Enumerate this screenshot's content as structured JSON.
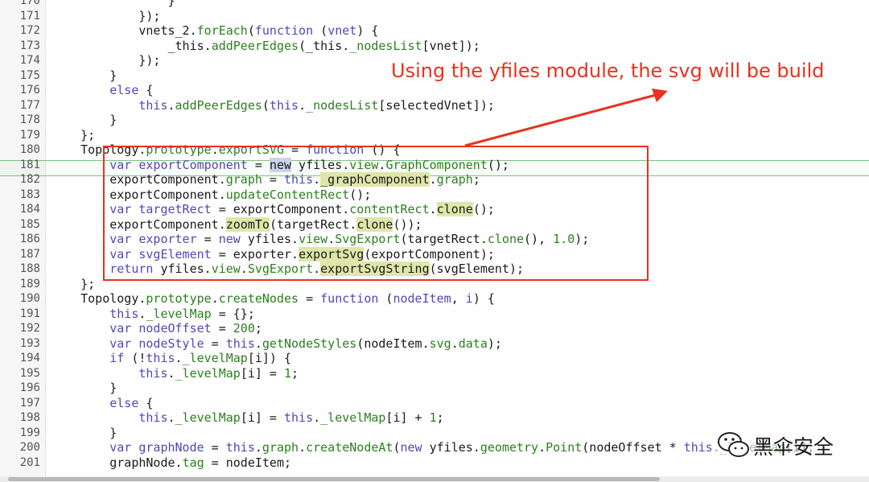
{
  "lines": [
    {
      "n": "170",
      "t": [
        [
          "                }"
        ]
      ]
    },
    {
      "n": "171",
      "t": [
        [
          "            });"
        ]
      ]
    },
    {
      "n": "172",
      "t": [
        [
          "            vnets_2."
        ],
        [
          "forEach",
          "mb"
        ],
        [
          "("
        ],
        [
          "function",
          "kw"
        ],
        [
          " ("
        ],
        [
          "vnet",
          "kw"
        ],
        [
          ") {"
        ]
      ]
    },
    {
      "n": "173",
      "t": [
        [
          "                _this."
        ],
        [
          "addPeerEdges",
          "mb"
        ],
        [
          "(_this."
        ],
        [
          "_nodesList",
          "mb"
        ],
        [
          "[vnet]);"
        ]
      ]
    },
    {
      "n": "174",
      "t": [
        [
          "            });"
        ]
      ]
    },
    {
      "n": "175",
      "t": [
        [
          "        }"
        ]
      ]
    },
    {
      "n": "176",
      "t": [
        [
          "        "
        ],
        [
          "else",
          "kw"
        ],
        [
          " {"
        ]
      ]
    },
    {
      "n": "177",
      "t": [
        [
          "            "
        ],
        [
          "this",
          "th"
        ],
        [
          "."
        ],
        [
          "addPeerEdges",
          "mb"
        ],
        [
          "("
        ],
        [
          "this",
          "th"
        ],
        [
          "."
        ],
        [
          "_nodesList",
          "mb"
        ],
        [
          "[selectedVnet]);"
        ]
      ]
    },
    {
      "n": "178",
      "t": [
        [
          "        }"
        ]
      ]
    },
    {
      "n": "179",
      "t": [
        [
          "    };"
        ]
      ]
    },
    {
      "n": "180",
      "t": [
        [
          "    Topology."
        ],
        [
          "prototype",
          "mb"
        ],
        [
          "."
        ],
        [
          "exportSVG",
          "mb"
        ],
        [
          " = "
        ],
        [
          "function",
          "kw"
        ],
        [
          " () {"
        ]
      ]
    },
    {
      "n": "181",
      "t": [
        [
          "        "
        ],
        [
          "var",
          "kw"
        ],
        [
          " "
        ],
        [
          "exportComponent",
          "kw"
        ],
        [
          " = "
        ],
        [
          "new",
          "hlk"
        ],
        [
          " yfiles."
        ],
        [
          "view",
          "mb"
        ],
        [
          "."
        ],
        [
          "GraphComponent",
          "mb"
        ],
        [
          "();"
        ]
      ]
    },
    {
      "n": "182",
      "t": [
        [
          "        exportComponent."
        ],
        [
          "graph",
          "mb"
        ],
        [
          " = "
        ],
        [
          "this",
          "th"
        ],
        [
          "."
        ],
        [
          "_graphComponent",
          "hl"
        ],
        [
          "."
        ],
        [
          "graph",
          "mb"
        ],
        [
          ";"
        ]
      ]
    },
    {
      "n": "183",
      "t": [
        [
          "        exportComponent."
        ],
        [
          "updateContentRect",
          "mb"
        ],
        [
          "();"
        ]
      ]
    },
    {
      "n": "184",
      "t": [
        [
          "        "
        ],
        [
          "var",
          "kw"
        ],
        [
          " "
        ],
        [
          "targetRect",
          "kw"
        ],
        [
          " = exportComponent."
        ],
        [
          "contentRect",
          "mb"
        ],
        [
          "."
        ],
        [
          "clone",
          "hl"
        ],
        [
          "();"
        ]
      ]
    },
    {
      "n": "185",
      "t": [
        [
          "        exportComponent."
        ],
        [
          "zoomTo",
          "hl"
        ],
        [
          "(targetRect."
        ],
        [
          "clone",
          "hl"
        ],
        [
          "());"
        ]
      ]
    },
    {
      "n": "186",
      "t": [
        [
          "        "
        ],
        [
          "var",
          "kw"
        ],
        [
          " "
        ],
        [
          "exporter",
          "kw"
        ],
        [
          " = "
        ],
        [
          "new",
          "kw"
        ],
        [
          " yfiles."
        ],
        [
          "view",
          "mb"
        ],
        [
          "."
        ],
        [
          "SvgExport",
          "mb"
        ],
        [
          "(targetRect."
        ],
        [
          "clone",
          "mb"
        ],
        [
          "(), "
        ],
        [
          "1.0",
          "num"
        ],
        [
          ");"
        ]
      ]
    },
    {
      "n": "187",
      "t": [
        [
          "        "
        ],
        [
          "var",
          "kw"
        ],
        [
          " "
        ],
        [
          "svgElement",
          "kw"
        ],
        [
          " = exporter."
        ],
        [
          "exportSvg",
          "hl"
        ],
        [
          "(exportComponent);"
        ]
      ]
    },
    {
      "n": "188",
      "t": [
        [
          "        "
        ],
        [
          "return",
          "kw"
        ],
        [
          " yfiles."
        ],
        [
          "view",
          "mb"
        ],
        [
          "."
        ],
        [
          "SvgExport",
          "mb"
        ],
        [
          "."
        ],
        [
          "exportSvgString",
          "hl"
        ],
        [
          "(svgElement);"
        ]
      ]
    },
    {
      "n": "189",
      "t": [
        [
          "    };"
        ]
      ]
    },
    {
      "n": "190",
      "t": [
        [
          "    Topology."
        ],
        [
          "prototype",
          "mb"
        ],
        [
          "."
        ],
        [
          "createNodes",
          "mb"
        ],
        [
          " = "
        ],
        [
          "function",
          "kw"
        ],
        [
          " ("
        ],
        [
          "nodeItem",
          "kw"
        ],
        [
          ", "
        ],
        [
          "i",
          "kw"
        ],
        [
          ") {"
        ]
      ]
    },
    {
      "n": "191",
      "t": [
        [
          "        "
        ],
        [
          "this",
          "th"
        ],
        [
          "."
        ],
        [
          "_levelMap",
          "mb"
        ],
        [
          " = {};"
        ]
      ]
    },
    {
      "n": "192",
      "t": [
        [
          "        "
        ],
        [
          "var",
          "kw"
        ],
        [
          " "
        ],
        [
          "nodeOffset",
          "kw"
        ],
        [
          " = "
        ],
        [
          "200",
          "num"
        ],
        [
          ";"
        ]
      ]
    },
    {
      "n": "193",
      "t": [
        [
          "        "
        ],
        [
          "var",
          "kw"
        ],
        [
          " "
        ],
        [
          "nodeStyle",
          "kw"
        ],
        [
          " = "
        ],
        [
          "this",
          "th"
        ],
        [
          "."
        ],
        [
          "getNodeStyles",
          "mb"
        ],
        [
          "(nodeItem."
        ],
        [
          "svg",
          "mb"
        ],
        [
          "."
        ],
        [
          "data",
          "mb"
        ],
        [
          ");"
        ]
      ]
    },
    {
      "n": "194",
      "t": [
        [
          "        "
        ],
        [
          "if",
          "kw"
        ],
        [
          " (!"
        ],
        [
          "this",
          "th"
        ],
        [
          "."
        ],
        [
          "_levelMap",
          "mb"
        ],
        [
          "[i]) {"
        ]
      ]
    },
    {
      "n": "195",
      "t": [
        [
          "            "
        ],
        [
          "this",
          "th"
        ],
        [
          "."
        ],
        [
          "_levelMap",
          "mb"
        ],
        [
          "[i] = "
        ],
        [
          "1",
          "num"
        ],
        [
          ";"
        ]
      ]
    },
    {
      "n": "196",
      "t": [
        [
          "        }"
        ]
      ]
    },
    {
      "n": "197",
      "t": [
        [
          "        "
        ],
        [
          "else",
          "kw"
        ],
        [
          " {"
        ]
      ]
    },
    {
      "n": "198",
      "t": [
        [
          "            "
        ],
        [
          "this",
          "th"
        ],
        [
          "."
        ],
        [
          "_levelMap",
          "mb"
        ],
        [
          "[i] = "
        ],
        [
          "this",
          "th"
        ],
        [
          "."
        ],
        [
          "_levelMap",
          "mb"
        ],
        [
          "[i] + "
        ],
        [
          "1",
          "num"
        ],
        [
          ";"
        ]
      ]
    },
    {
      "n": "199",
      "t": [
        [
          "        }"
        ]
      ]
    },
    {
      "n": "200",
      "t": [
        [
          "        "
        ],
        [
          "var",
          "kw"
        ],
        [
          " "
        ],
        [
          "graphNode",
          "kw"
        ],
        [
          " = "
        ],
        [
          "this",
          "th"
        ],
        [
          "."
        ],
        [
          "graph",
          "mb"
        ],
        [
          "."
        ],
        [
          "createNodeAt",
          "mb"
        ],
        [
          "("
        ],
        [
          "new",
          "kw"
        ],
        [
          " yfiles."
        ],
        [
          "geometry",
          "mb"
        ],
        [
          "."
        ],
        [
          "Point",
          "mb"
        ],
        [
          "(nodeOffset * "
        ],
        [
          "this",
          "th"
        ],
        [
          "."
        ],
        [
          "_levelMap",
          "mb"
        ],
        [
          "[i],"
        ]
      ]
    },
    {
      "n": "201",
      "t": [
        [
          "        graphNode."
        ],
        [
          "tag",
          "mb"
        ],
        [
          " = nodeItem;"
        ]
      ]
    }
  ],
  "annotation": {
    "text": "Using the yfiles module, the svg will be build",
    "color": "#e8321f"
  },
  "watermark": {
    "text": "黑伞安全",
    "icon": "wechat-icon"
  },
  "colors": {
    "keyword": "#4f49b8",
    "member": "#2c7f1f",
    "highlight": "#dfe6a9",
    "annotation": "#e8321f",
    "active_line": "#7cc47f"
  }
}
